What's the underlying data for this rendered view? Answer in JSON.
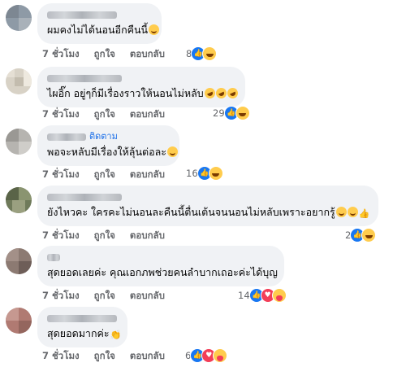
{
  "comments": [
    {
      "text": "ผมคงไม่ได้นอนอีกคืนนี้",
      "time": "7 ชั่วโมง",
      "like": "ถูกใจ",
      "reply": "ตอบกลับ",
      "reaction_count": "8",
      "reactions": [
        "like-icon",
        "haha-icon"
      ],
      "emojis": [
        "smile-emoji"
      ]
    },
    {
      "text": "ไผอิ๊ก อยู่ๆก็มีเรื่องราวให้นอนไม่หลับ",
      "time": "7 ชั่วโมง",
      "like": "ถูกใจ",
      "reply": "ตอบกลับ",
      "reaction_count": "29",
      "reactions": [
        "like-icon",
        "haha-icon"
      ],
      "emojis": [
        "rofl-emoji",
        "rofl-emoji",
        "rofl-emoji"
      ]
    },
    {
      "follow": "ติดตาม",
      "text": "พอจะหลับมีเรื่องให้ลุ้นต่อละ",
      "time": "7 ชั่วโมง",
      "like": "ถูกใจ",
      "reply": "ตอบกลับ",
      "reaction_count": "16",
      "reactions": [
        "like-icon",
        "haha-icon"
      ],
      "emojis": [
        "smile-emoji"
      ]
    },
    {
      "text": "ยังไหวคะ ใครคะไม่นอนละคืนนี้ตื่นเต้นจนนอนไม่หลับเพราะอยากรู้",
      "time": "7 ชั่วโมง",
      "like": "ถูกใจ",
      "reply": "ตอบกลับ",
      "reaction_count": "2",
      "reactions": [
        "like-icon",
        "haha-icon"
      ],
      "emojis": [
        "smile-emoji",
        "smile-emoji",
        "thumbs-up-emoji"
      ]
    },
    {
      "text": "สุดยอดเลยค่ะ คุณเอกภพช่วยคนลำบากเถอะค่ะได้บุญ",
      "time": "7 ชั่วโมง",
      "like": "ถูกใจ",
      "reply": "ตอบกลับ",
      "reaction_count": "14",
      "reactions": [
        "like-icon",
        "love-icon",
        "care-icon"
      ],
      "emojis": []
    },
    {
      "text": "สุดยอดมากค่ะ",
      "time": "7 ชั่วโมง",
      "like": "ถูกใจ",
      "reply": "ตอบกลับ",
      "reaction_count": "6",
      "reactions": [
        "like-icon",
        "love-icon",
        "care-icon"
      ],
      "emojis": [
        "clapping-emoji"
      ]
    }
  ],
  "colors": {
    "bubble": "#f0f2f5",
    "meta_text": "#65676b",
    "follow_link": "#1a6ee8",
    "like_blue": "#1877f2",
    "love_red": "#f33e58",
    "emoji_yellow": "#ffcc4d"
  }
}
